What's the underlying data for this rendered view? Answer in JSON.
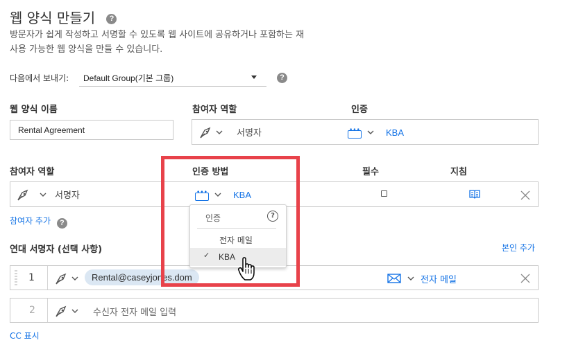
{
  "header": {
    "title": "웹 양식 만들기",
    "help": "?",
    "description_line1": "방문자가 쉽게 작성하고 서명할 수 있도록 웹 사이트에 공유하거나 포함하는 재",
    "description_line2": "사용 가능한 웹 양식을 만들 수 있습니다."
  },
  "send_from": {
    "label": "다음에서 보내기:",
    "value": "Default Group(기본 그룹)"
  },
  "form_name": {
    "label": "웹 양식 이름",
    "value": "Rental Agreement"
  },
  "top_role": {
    "label": "참여자 역할",
    "value": "서명자",
    "auth_label": "인증",
    "auth_value": "KBA"
  },
  "participants": {
    "headers": {
      "role": "참여자 역할",
      "auth_method": "인증 방법",
      "required": "필수",
      "instructions": "지침"
    },
    "row": {
      "role": "서명자",
      "auth": "KBA"
    },
    "add_label": "참여자 추가"
  },
  "auth_dropdown": {
    "header": "인증",
    "help": "?",
    "options": [
      "전자 메일",
      "KBA"
    ],
    "selected": "KBA",
    "check": "✓"
  },
  "cosigners": {
    "label": "연대 서명자 (선택 사항)",
    "add_self": "본인 추가",
    "rows": [
      {
        "number": "1",
        "email": "Rental@caseyjones.dom",
        "method": "전자 메일"
      },
      {
        "number": "2",
        "placeholder": "수신자 전자 메일 입력"
      }
    ]
  },
  "cc_label": "CC 표시",
  "colors": {
    "accent": "#1473e6",
    "highlight_border": "#e8424a",
    "pill_bg": "#dbe7f3"
  },
  "icons": [
    "help-icon",
    "pen-icon",
    "chevron-down-icon",
    "kba-icon",
    "book-icon",
    "close-icon",
    "mail-icon",
    "drag-handle-icon",
    "hand-cursor-icon",
    "checkmark-icon"
  ]
}
